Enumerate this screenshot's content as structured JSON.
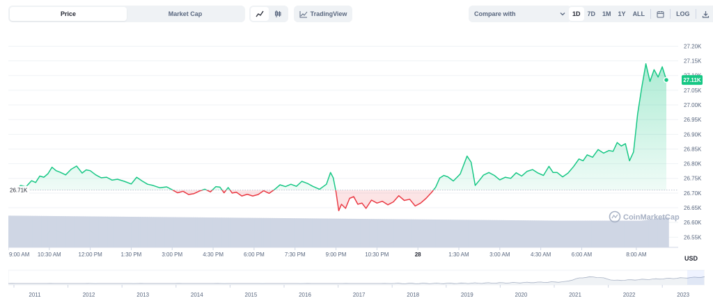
{
  "toolbar": {
    "tabs": [
      {
        "label": "Price",
        "active": true
      },
      {
        "label": "Market Cap",
        "active": false
      }
    ],
    "chart_types": [
      {
        "icon": "line-chart-icon",
        "active": true
      },
      {
        "icon": "candlestick-icon",
        "active": false
      }
    ],
    "tradingview_label": "TradingView",
    "tradingview_icon": "tradingview-icon",
    "compare_label": "Compare with",
    "compare_icon": "chevron-down-icon",
    "ranges": [
      {
        "label": "1D",
        "active": true
      },
      {
        "label": "7D",
        "active": false
      },
      {
        "label": "1M",
        "active": false
      },
      {
        "label": "1Y",
        "active": false
      },
      {
        "label": "ALL",
        "active": false
      }
    ],
    "calendar_icon": "calendar-icon",
    "log_label": "LOG",
    "download_icon": "download-icon"
  },
  "colors": {
    "up": "#16c784",
    "down": "#ea3943",
    "volume": "#cfd6e4",
    "price_badge": "#16c784",
    "grid": "#eff2f5",
    "axis_text": "#58667e"
  },
  "watermark": "CoinMarketCap",
  "currency_label": "USD",
  "chart_data": {
    "type": "area",
    "open_price_label": "26.71K",
    "current_price_label": "27.11K",
    "open_price": 26.71,
    "ylim": [
      26.52,
      27.22
    ],
    "yticks": [
      "27.20K",
      "27.15K",
      "27.10K",
      "27.05K",
      "27.00K",
      "26.95K",
      "26.90K",
      "26.85K",
      "26.80K",
      "26.75K",
      "26.70K",
      "26.65K",
      "26.60K",
      "26.55K"
    ],
    "ytick_values": [
      27.2,
      27.15,
      27.1,
      27.05,
      27.0,
      26.95,
      26.9,
      26.85,
      26.8,
      26.75,
      26.7,
      26.65,
      26.6,
      26.55
    ],
    "xticks": [
      "9:00 AM",
      "10:30 AM",
      "12:00 PM",
      "1:30 PM",
      "3:00 PM",
      "4:30 PM",
      "6:00 PM",
      "7:30 PM",
      "9:00 PM",
      "10:30 PM",
      "28",
      "1:30 AM",
      "3:00 AM",
      "4:30 AM",
      "6:00 AM",
      "8:00 AM"
    ],
    "xtick_hours": [
      0,
      1.5,
      3,
      4.5,
      6,
      7.5,
      9,
      10.5,
      12,
      13.5,
      15,
      16.5,
      18,
      19.5,
      21,
      23
    ],
    "price_hours": [
      0,
      0.05,
      0.25,
      0.45,
      0.65,
      0.85,
      1.0,
      1.15,
      1.3,
      1.45,
      1.6,
      1.75,
      1.9,
      2.1,
      2.3,
      2.5,
      2.7,
      2.85,
      3.0,
      3.2,
      3.4,
      3.6,
      3.8,
      4.0,
      4.25,
      4.5,
      4.7,
      4.9,
      5.1,
      5.3,
      5.55,
      5.8,
      6.0,
      6.2,
      6.4,
      6.6,
      6.8,
      7.0,
      7.2,
      7.4,
      7.6,
      7.75,
      7.9,
      8.05,
      8.2,
      8.35,
      8.55,
      8.75,
      8.95,
      9.15,
      9.35,
      9.55,
      9.75,
      9.95,
      10.15,
      10.35,
      10.55,
      10.75,
      10.95,
      11.15,
      11.4,
      11.65,
      11.8,
      11.9,
      12.0,
      12.1,
      12.2,
      12.35,
      12.5,
      12.65,
      12.8,
      12.95,
      13.1,
      13.3,
      13.5,
      13.7,
      13.9,
      14.1,
      14.3,
      14.5,
      14.7,
      14.9,
      15.1,
      15.3,
      15.5,
      15.65,
      15.8,
      15.95,
      16.1,
      16.3,
      16.55,
      16.8,
      16.95,
      17.1,
      17.25,
      17.4,
      17.6,
      17.8,
      18.0,
      18.2,
      18.4,
      18.6,
      18.8,
      19.0,
      19.2,
      19.4,
      19.6,
      19.8,
      19.95,
      20.1,
      20.3,
      20.5,
      20.7,
      20.9,
      21.05,
      21.2,
      21.4,
      21.6,
      21.8,
      22.0,
      22.15,
      22.3,
      22.45,
      22.6,
      22.75,
      22.9,
      23.05,
      23.2,
      23.35,
      23.5,
      23.65,
      23.8,
      23.95,
      24.1
    ],
    "price_values": [
      26.715,
      26.722,
      26.712,
      26.726,
      26.722,
      26.742,
      26.736,
      26.758,
      26.754,
      26.766,
      26.788,
      26.776,
      26.771,
      26.762,
      26.781,
      26.792,
      26.768,
      26.779,
      26.776,
      26.762,
      26.752,
      26.754,
      26.744,
      26.747,
      26.74,
      26.731,
      26.754,
      26.741,
      26.73,
      26.726,
      26.718,
      26.721,
      26.711,
      26.701,
      26.706,
      26.695,
      26.698,
      26.707,
      26.713,
      26.704,
      26.722,
      26.72,
      26.701,
      26.719,
      26.7,
      26.703,
      26.69,
      26.696,
      26.69,
      26.695,
      26.708,
      26.699,
      26.712,
      26.728,
      26.722,
      26.73,
      26.723,
      26.74,
      26.733,
      26.723,
      26.713,
      26.73,
      26.77,
      26.752,
      26.705,
      26.64,
      26.662,
      26.648,
      26.682,
      26.688,
      26.662,
      26.666,
      26.648,
      26.676,
      26.666,
      26.672,
      26.66,
      26.67,
      26.691,
      26.675,
      26.679,
      26.656,
      26.666,
      26.682,
      26.702,
      26.72,
      26.751,
      26.76,
      26.755,
      26.741,
      26.765,
      26.826,
      26.805,
      26.726,
      26.743,
      26.761,
      26.77,
      26.76,
      26.745,
      26.754,
      26.75,
      26.769,
      26.758,
      26.774,
      26.78,
      26.768,
      26.76,
      26.791,
      26.77,
      26.77,
      26.755,
      26.768,
      26.79,
      26.816,
      26.81,
      26.83,
      26.822,
      26.848,
      26.836,
      26.845,
      26.842,
      26.872,
      26.86,
      26.868,
      26.81,
      26.84,
      26.97,
      27.06,
      27.14,
      27.08,
      27.12,
      27.095,
      27.13,
      27.085,
      27.11
    ],
    "volume_level_start": 0.95,
    "volume_level_end": 0.8
  },
  "navigator": {
    "years": [
      "2011",
      "2012",
      "2013",
      "2014",
      "2015",
      "2016",
      "2017",
      "2018",
      "2019",
      "2020",
      "2021",
      "2022",
      "2023"
    ]
  }
}
